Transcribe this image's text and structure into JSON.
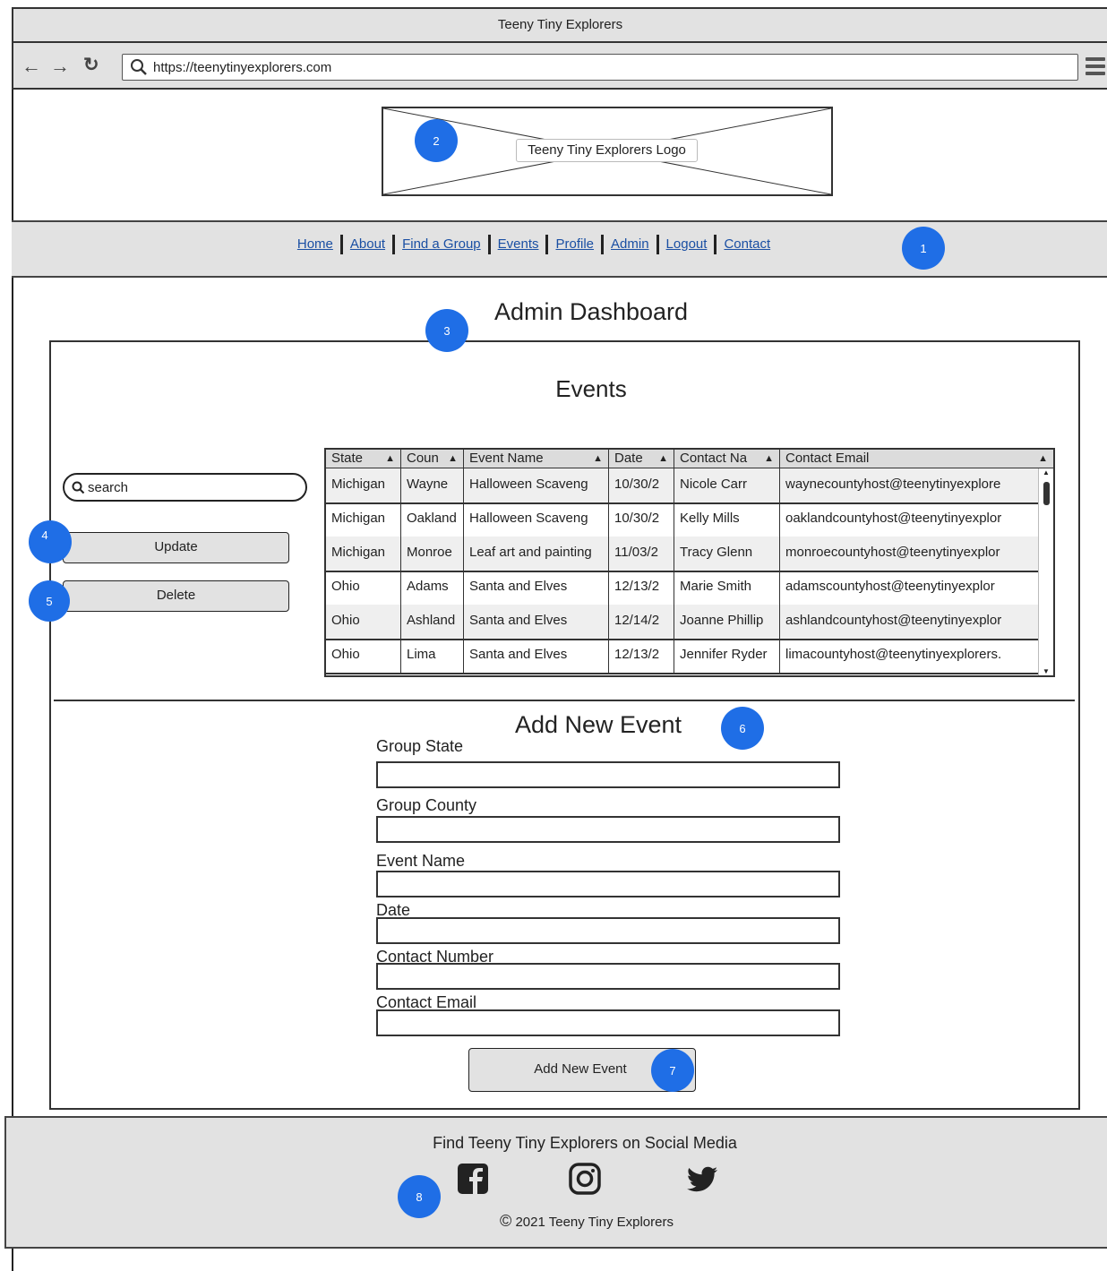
{
  "browser": {
    "window_title": "Teeny Tiny Explorers",
    "url": "https://teenytinyexplorers.com"
  },
  "header": {
    "logo_label": "Teeny Tiny Explorers Logo"
  },
  "nav": {
    "items": [
      "Home",
      "About",
      "Find a Group",
      "Events",
      "Profile",
      "Admin",
      "Logout",
      "Contact"
    ]
  },
  "badges": [
    "1",
    "2",
    "3",
    "4",
    "5",
    "6",
    "7",
    "8"
  ],
  "main": {
    "page_title": "Admin Dashboard",
    "events_title": "Events",
    "search_placeholder": "search",
    "update_label": "Update",
    "delete_label": "Delete"
  },
  "table": {
    "columns": [
      "State",
      "Coun",
      "Event Name",
      "Date",
      "Contact Na",
      "Contact Email"
    ],
    "rows": [
      [
        "Michigan",
        "Wayne",
        "Halloween Scaveng",
        "10/30/2",
        "Nicole Carr",
        "waynecountyhost@teenytinyexplore"
      ],
      [
        "Michigan",
        "Oakland",
        "Halloween Scaveng",
        "10/30/2",
        "Kelly Mills",
        "oaklandcountyhost@teenytinyexplor"
      ],
      [
        "Michigan",
        "Monroe",
        "Leaf art and painting",
        "11/03/2",
        "Tracy Glenn",
        "monroecountyhost@teenytinyexplor"
      ],
      [
        "Ohio",
        "Adams",
        "Santa and Elves",
        "12/13/2",
        "Marie Smith",
        "adamscountyhost@teenytinyexplor"
      ],
      [
        "Ohio",
        "Ashland",
        "Santa and Elves",
        "12/14/2",
        "Joanne Phillip",
        "ashlandcountyhost@teenytinyexplor"
      ],
      [
        "Ohio",
        "Lima",
        "Santa and Elves",
        "12/13/2",
        "Jennifer Ryder",
        "limacountyhost@teenytinyexplorers."
      ]
    ]
  },
  "form": {
    "title": "Add New Event",
    "fields": [
      "Group State",
      "Group County",
      "Event Name",
      "Date",
      "Contact Number",
      "Contact Email"
    ],
    "submit_label": "Add New Event"
  },
  "footer": {
    "title": "Find Teeny Tiny Explorers on Social Media",
    "copyright": "2021 Teeny Tiny Explorers",
    "social_icons": [
      "facebook-icon",
      "instagram-icon",
      "twitter-icon"
    ]
  },
  "colors": {
    "badge": "#1f6ee6",
    "link": "#1a4fa3",
    "chrome": "#e2e2e2"
  }
}
